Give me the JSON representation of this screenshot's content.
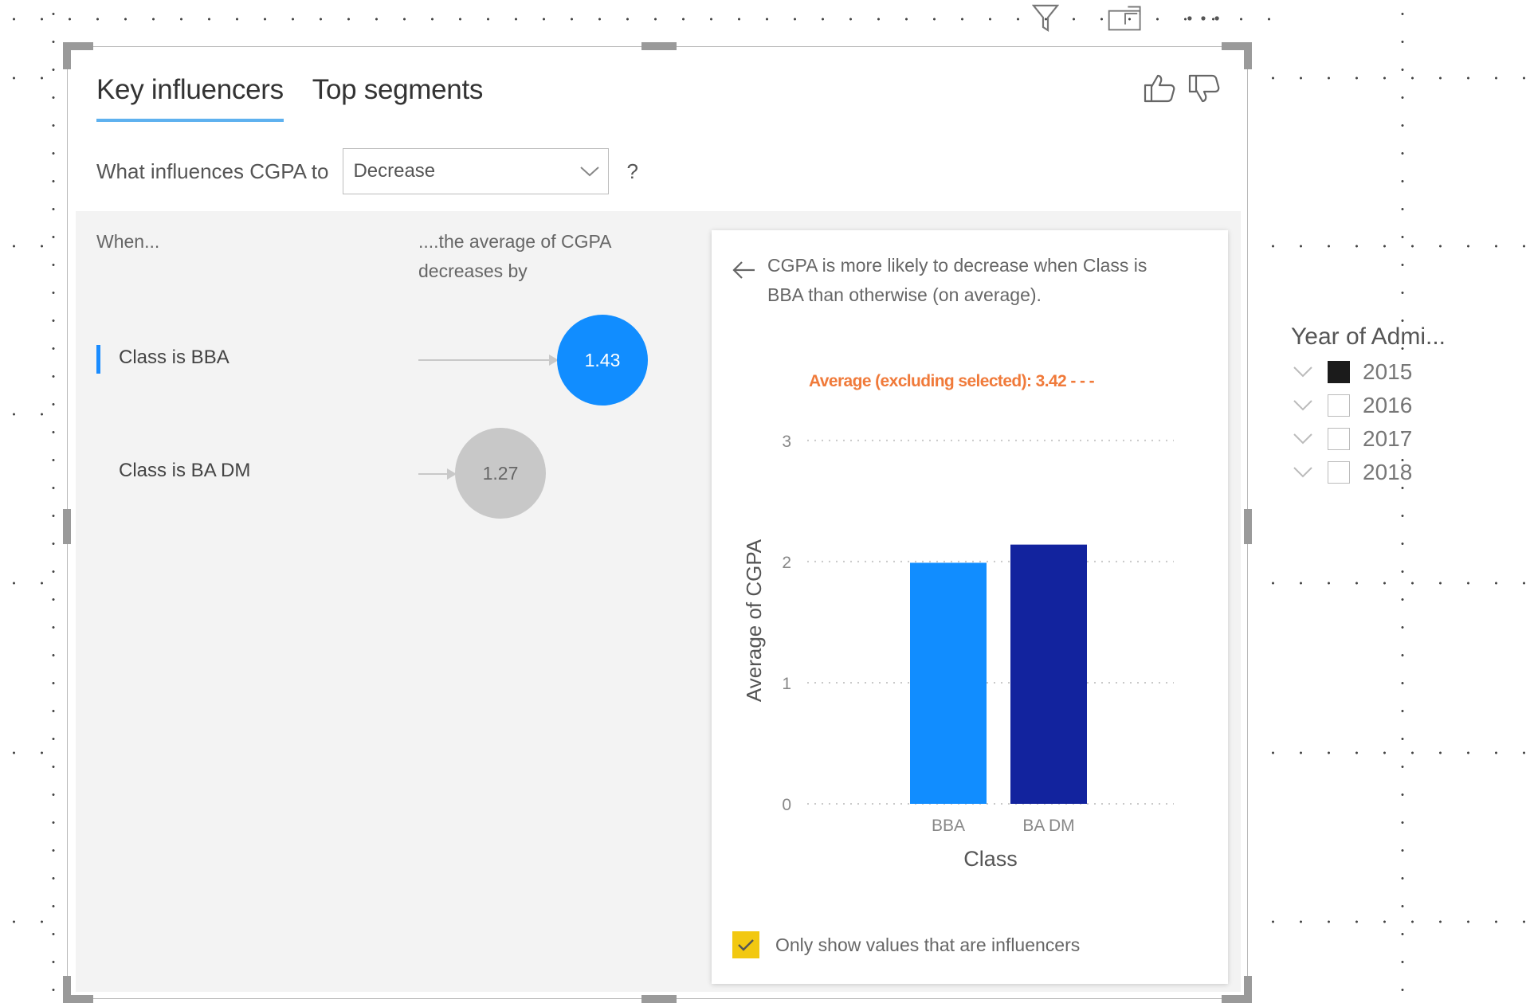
{
  "header_icons": [
    {
      "name": "filter-icon"
    },
    {
      "name": "focus-mode-icon"
    },
    {
      "name": "more-options-icon"
    }
  ],
  "visual": {
    "tabs": [
      {
        "label": "Key influencers",
        "active": true
      },
      {
        "label": "Top segments",
        "active": false
      }
    ],
    "question": {
      "prefix": "What influences CGPA to",
      "dropdown_value": "Decrease",
      "help": "?"
    },
    "columns": {
      "when": "When...",
      "effect_line1": "....the average of CGPA",
      "effect_line2": "decreases by"
    },
    "influencers": [
      {
        "label": "Class is BBA",
        "value": "1.43",
        "selected": true
      },
      {
        "label": "Class is BA DM",
        "value": "1.27",
        "selected": false
      }
    ],
    "detail": {
      "text_line1": "CGPA is more likely to decrease when Class is",
      "text_line2": "BBA than otherwise (on average).",
      "avg_note": "Average (excluding selected): 3.42",
      "checkbox_label": "Only show values that are influencers",
      "checkbox_checked": true
    }
  },
  "chart_data": {
    "type": "bar",
    "categories": [
      "BBA",
      "BA DM"
    ],
    "values": [
      1.99,
      2.14
    ],
    "colors": [
      "#118dff",
      "#12239e"
    ],
    "xlabel": "Class",
    "ylabel": "Average of CGPA",
    "yticks": [
      0,
      1,
      2,
      3
    ],
    "ylim": [
      0,
      3.42
    ],
    "reference_line": {
      "value": 3.42,
      "label": "Average (excluding selected): 3.42",
      "color": "#f07a3a"
    },
    "grid": true
  },
  "slicer": {
    "title": "Year of Admi...",
    "items": [
      {
        "label": "2015",
        "checked": true
      },
      {
        "label": "2016",
        "checked": false
      },
      {
        "label": "2017",
        "checked": false
      },
      {
        "label": "2018",
        "checked": false
      }
    ]
  },
  "colors": {
    "accent": "#118dff",
    "selected_bubble": "#118dff",
    "unselected_bubble": "#c8c8c8",
    "checkbox": "#f2c811",
    "reference": "#f07a3a"
  }
}
